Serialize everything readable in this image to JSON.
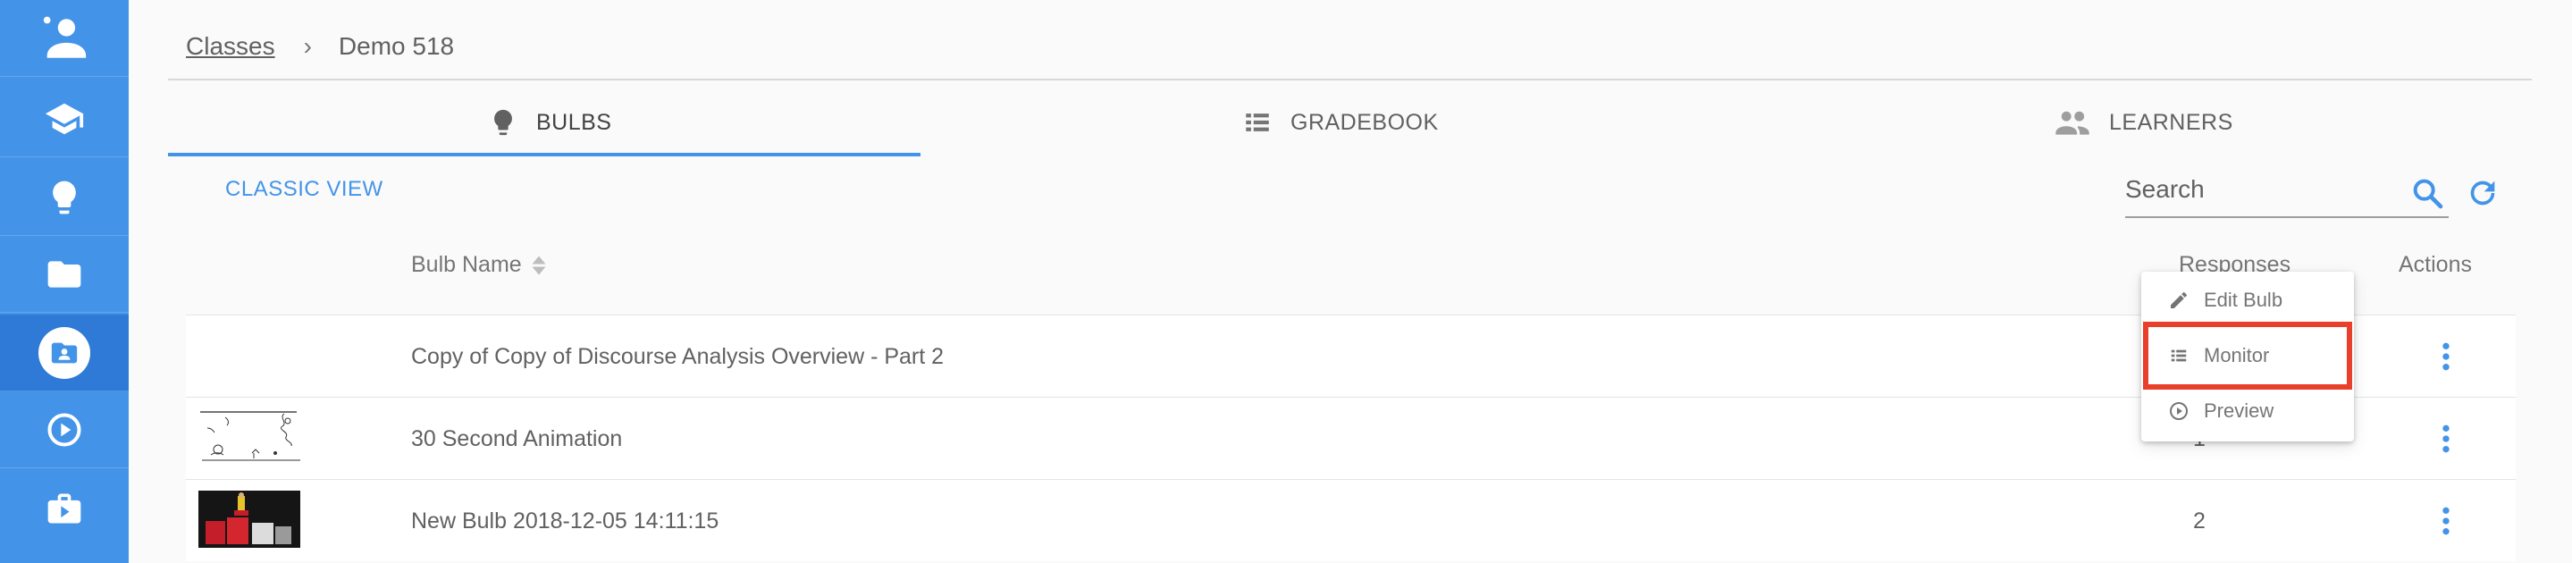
{
  "sidebar": {
    "items": [
      {
        "icon": "user-profile-icon"
      },
      {
        "icon": "graduation-cap-icon"
      },
      {
        "icon": "lightbulb-icon"
      },
      {
        "icon": "folder-icon"
      },
      {
        "icon": "class-account-icon",
        "active": true
      },
      {
        "icon": "play-circle-icon"
      },
      {
        "icon": "briefcase-play-icon"
      }
    ],
    "color": "#4394e8",
    "active_color": "#2e7ad6"
  },
  "breadcrumb": {
    "link": "Classes",
    "separator": "›",
    "current": "Demo 518"
  },
  "tabs": [
    {
      "label": "BULBS",
      "icon": "lightbulb-icon",
      "active": true
    },
    {
      "label": "GRADEBOOK",
      "icon": "list-icon"
    },
    {
      "label": "LEARNERS",
      "icon": "people-icon"
    }
  ],
  "toolbar": {
    "classic_view": "CLASSIC VIEW",
    "search_placeholder": "Search"
  },
  "table": {
    "headers": {
      "name": "Bulb Name",
      "responses": "Responses",
      "actions": "Actions"
    },
    "rows": [
      {
        "name": "Copy of Copy of Discourse Analysis Overview - Part 2",
        "responses": "",
        "thumbnail": "none"
      },
      {
        "name": "30 Second Animation",
        "responses": "1",
        "thumbnail": "sketch"
      },
      {
        "name": "New Bulb 2018-12-05 14:11:15",
        "responses": "2",
        "thumbnail": "photo"
      }
    ]
  },
  "actions_menu": {
    "items": [
      {
        "label": "Edit Bulb",
        "icon": "pencil-icon"
      },
      {
        "label": "Monitor",
        "icon": "list-icon",
        "highlighted": true
      },
      {
        "label": "Preview",
        "icon": "play-circle-icon"
      }
    ],
    "highlight_color": "#e8402a"
  },
  "accent_color": "#4394e8"
}
